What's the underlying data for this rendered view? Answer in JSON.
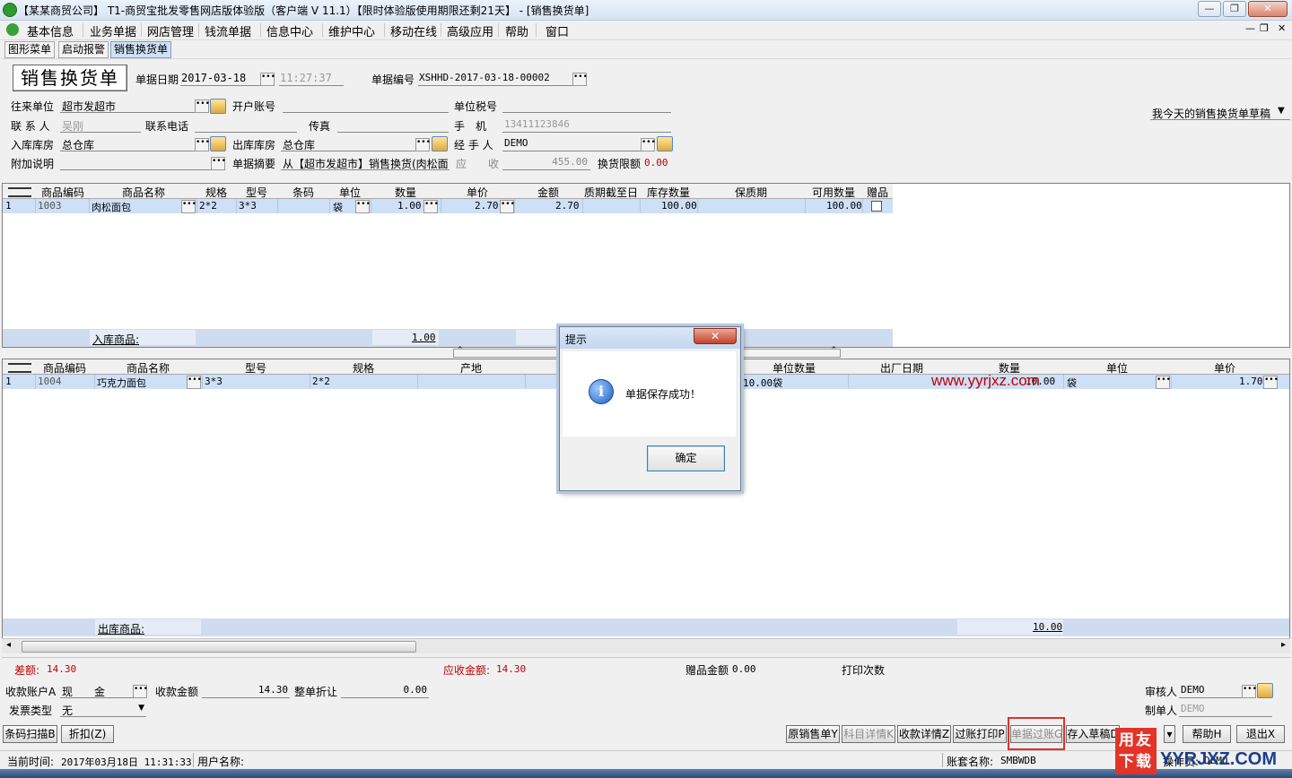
{
  "window": {
    "title": "【某某商贸公司】 T1-商贸宝批发零售网店版体验版（客户端 V 11.1）【限时体验版使用期限还剩21天】 - [销售换货单]",
    "controls": {
      "minimize": "—",
      "restore": "❐",
      "close": "✕"
    }
  },
  "menu": {
    "items": [
      "基本信息",
      "业务单据",
      "网店管理",
      "钱流单据",
      "信息中心",
      "维护中心",
      "移动在线",
      "高级应用",
      "帮助",
      "窗口"
    ],
    "right_controls": {
      "minimize": "—",
      "restore": "❐",
      "close": "✕"
    }
  },
  "tabs": [
    "图形菜单",
    "启动报警",
    "销售换货单"
  ],
  "form": {
    "doc_title": "销售换货单",
    "date_label": "单据日期",
    "date_value": "2017-03-18",
    "time_value": "11:27:37",
    "number_label": "单据编号",
    "number_value": "XSHHD-2017-03-18-00002",
    "partner_label": "往来单位",
    "partner_value": "超市发超市",
    "account_label": "开户账号",
    "tax_label": "单位税号",
    "contact_label": "联 系 人",
    "contact_value": "吴刚",
    "phone_label": "联系电话",
    "fax_label": "传真",
    "mobile_label": "手　机",
    "mobile_value": "13411123846",
    "in_store_label": "入库库房",
    "in_store_value": "总仓库",
    "out_store_label": "出库库房",
    "out_store_value": "总仓库",
    "handler_label": "经 手 人",
    "handler_value": "DEMO",
    "note_label": "附加说明",
    "summary_label": "单据摘要",
    "summary_value": "从【超市发超市】销售换货(肉松面",
    "receivable_label": "应　　收",
    "receivable_value": "455.00",
    "limit_label": "换货限额",
    "limit_value": "0.00",
    "draft_dropdown": "我今天的销售换货单草稿"
  },
  "in_grid": {
    "columns": [
      "商品编码",
      "商品名称",
      "规格",
      "型号",
      "条码",
      "单位",
      "数量",
      "单价",
      "金额",
      "质期截至日",
      "库存数量",
      "保质期",
      "可用数量",
      "赠品"
    ],
    "rows": [
      {
        "idx": "1",
        "code": "1003",
        "name": "肉松面包",
        "spec": "2*2",
        "model": "3*3",
        "barcode": "",
        "unit": "袋",
        "qty": "1.00",
        "price": "2.70",
        "amount": "2.70",
        "expiry": "",
        "stock": "100.00",
        "shelf": "",
        "available": "100.00"
      }
    ],
    "footer_label": "入库商品:",
    "footer_qty": "1.00"
  },
  "out_grid": {
    "columns": [
      "商品编码",
      "商品名称",
      "型号",
      "规格",
      "产地",
      "单位数量",
      "出厂日期",
      "数量",
      "单位",
      "单价"
    ],
    "rows": [
      {
        "idx": "1",
        "code": "1004",
        "name": "巧克力面包",
        "model": "3*3",
        "spec": "2*2",
        "origin": "",
        "unit_qty": "10.00袋",
        "mfg_date": "",
        "qty": "10.00",
        "unit": "袋",
        "price": "1.70"
      }
    ],
    "footer_label": "出库商品:",
    "footer_qty": "10.00",
    "watermark": "www.yyrjxz.com"
  },
  "dialog": {
    "title": "提示",
    "message": "单据保存成功！",
    "ok": "确定",
    "icon_glyph": "i"
  },
  "totals": {
    "diff_label": "差额:",
    "diff_value": "14.30",
    "receivable_label": "应收金额:",
    "receivable_value": "14.30",
    "gift_label": "赠品金额",
    "gift_value": "0.00",
    "print_label": "打印次数",
    "account_label": "收款账户A",
    "account_value": "现　　金",
    "collected_label": "收款金额",
    "collected_value": "14.30",
    "discount_label": "整单折让",
    "discount_value": "0.00",
    "invoice_label": "发票类型",
    "invoice_value": "无",
    "auditor_label": "审核人",
    "auditor_value": "DEMO",
    "maker_label": "制单人",
    "maker_value": "DEMO"
  },
  "buttons": {
    "scan": "条码扫描B",
    "discount": "折扣(Z)",
    "orig_sale": "原销售单Y",
    "subject_detail": "科目详情K",
    "collect_detail": "收款详情Z",
    "post_print": "过账打印P",
    "post": "单据过账G",
    "save_draft": "存入草稿D",
    "help": "帮助H",
    "exit": "退出X"
  },
  "status": {
    "time_label": "当前时间:",
    "time_value": "2017年03月18日  11:31:33",
    "user_label": "用户名称:",
    "set_label": "账套名称:",
    "set_value": "SMBWDB",
    "operator_label": "操作员:",
    "operator_value": "DEMO",
    "brand_text": "用友下载",
    "brand_url": "YYRJXZ.COM"
  },
  "colors": {
    "accent": "#cde0f7",
    "red": "#c00000",
    "dialog_border": "#b5c8e0"
  }
}
